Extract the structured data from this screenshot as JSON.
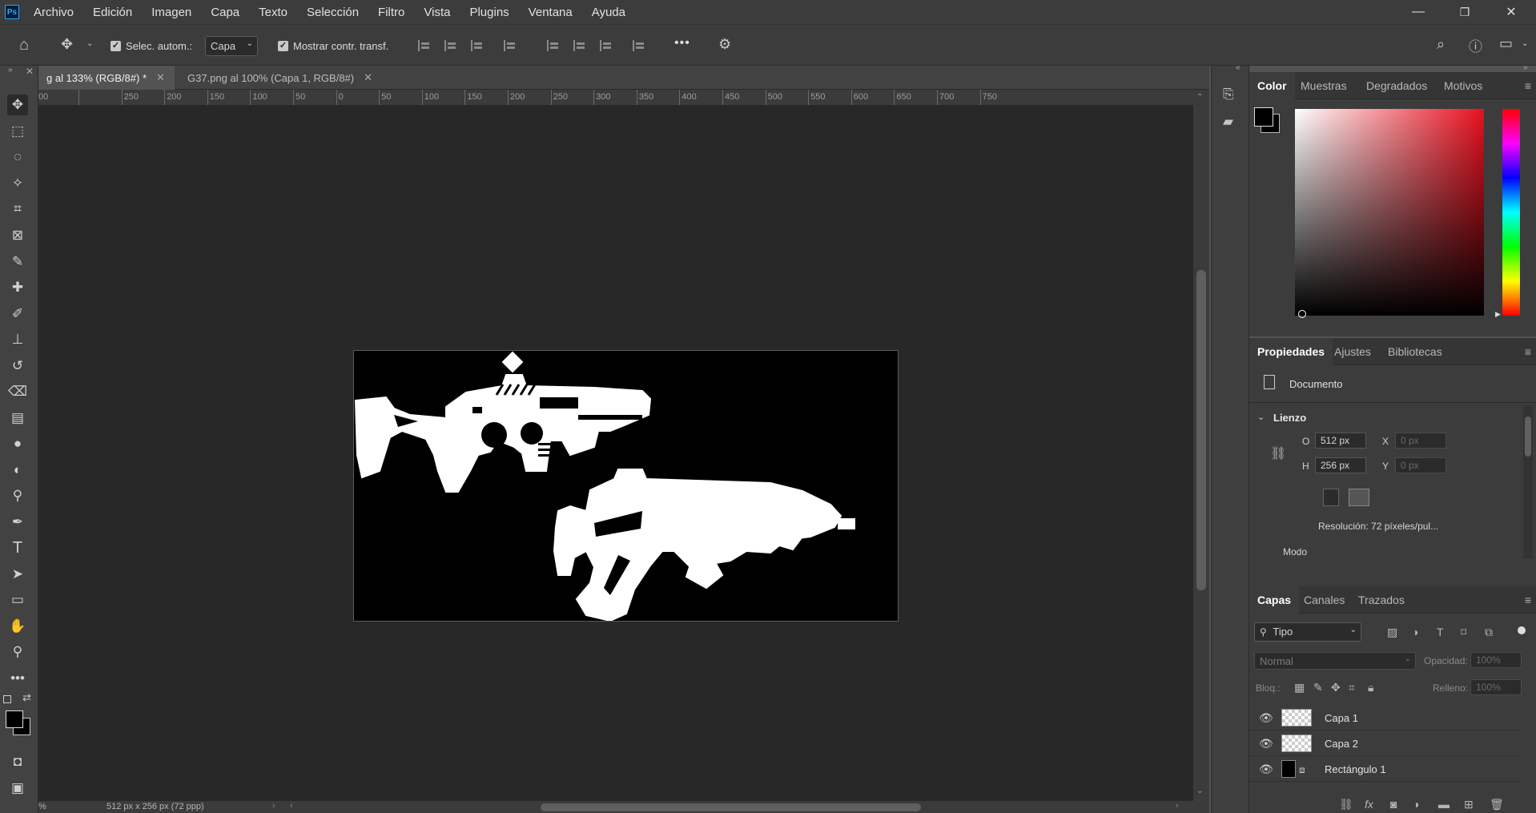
{
  "menubar": {
    "app_logo": "Ps",
    "items": [
      "Archivo",
      "Edición",
      "Imagen",
      "Capa",
      "Texto",
      "Selección",
      "Filtro",
      "Vista",
      "Plugins",
      "Ventana",
      "Ayuda"
    ],
    "window_controls": {
      "minimize": "—",
      "restore": "❐",
      "close": "✕"
    }
  },
  "options": {
    "auto_select_label": "Selec. autom.:",
    "auto_select_target": "Capa",
    "show_transform_label": "Mostrar contr. transf.",
    "more_label": "•••"
  },
  "tabs": [
    {
      "label": "g al 133% (RGB/8#) *",
      "active": true
    },
    {
      "label": "G37.png al 100% (Capa 1, RGB/8#)",
      "active": false
    }
  ],
  "ruler_labels": [
    "00",
    "250",
    "200",
    "150",
    "100",
    "50",
    "0",
    "50",
    "100",
    "150",
    "200",
    "250",
    "300",
    "350",
    "400",
    "450",
    "500",
    "550",
    "600",
    "650",
    "700",
    "750"
  ],
  "status": {
    "zoom_fragment": "%",
    "doc_info": "512 px x 256 px (72 ppp)"
  },
  "color_panel": {
    "tabs": [
      "Color",
      "Muestras",
      "Degradados",
      "Motivos"
    ],
    "foreground": "#000000",
    "background": "#000000",
    "hue_color": "#e8101e"
  },
  "properties_panel": {
    "tabs": [
      "Propiedades",
      "Ajustes",
      "Bibliotecas"
    ],
    "doc_label": "Documento",
    "section": "Lienzo",
    "width_label": "O",
    "width_value": "512 px",
    "height_label": "H",
    "height_value": "256 px",
    "x_label": "X",
    "x_placeholder": "0 px",
    "y_label": "Y",
    "y_placeholder": "0 px",
    "resolution": "Resolución: 72 píxeles/pul...",
    "mode_label": "Modo"
  },
  "layers_panel": {
    "tabs": [
      "Capas",
      "Canales",
      "Trazados"
    ],
    "filter_label": "Tipo",
    "blend_mode": "Normal",
    "opacity_label": "Opacidad:",
    "opacity_value": "100%",
    "lock_label": "Bloq.:",
    "fill_label": "Relleno:",
    "fill_value": "100%",
    "layers": [
      {
        "name": "Capa 1",
        "thumb": "transparent"
      },
      {
        "name": "Capa 2",
        "thumb": "transparent"
      },
      {
        "name": "Rectángulo 1",
        "thumb": "black-shape"
      }
    ]
  }
}
